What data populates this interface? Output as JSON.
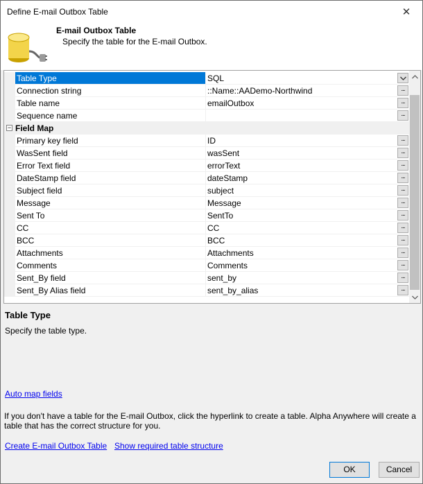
{
  "window": {
    "title": "Define E-mail Outbox Table",
    "close_glyph": "✕"
  },
  "header": {
    "icon": "database-plug-icon",
    "title": "E-mail Outbox Table",
    "subtitle": "Specify the table for the E-mail  Outbox."
  },
  "grid": {
    "rows_top": [
      {
        "name": "Table Type",
        "value": "SQL",
        "editor": "dropdown"
      },
      {
        "name": "Connection string",
        "value": "::Name::AADemo-Northwind",
        "editor": "ellipsis"
      },
      {
        "name": "Table name",
        "value": "emailOutbox",
        "editor": "ellipsis"
      },
      {
        "name": "Sequence name",
        "value": "",
        "editor": "ellipsis"
      }
    ],
    "category": {
      "label": "Field Map",
      "toggle": "−"
    },
    "rows_map": [
      {
        "name": "Primary key field",
        "value": "ID"
      },
      {
        "name": "WasSent field",
        "value": "wasSent"
      },
      {
        "name": "Error Text field",
        "value": "errorText"
      },
      {
        "name": "DateStamp field",
        "value": "dateStamp"
      },
      {
        "name": "Subject field",
        "value": "subject"
      },
      {
        "name": "Message",
        "value": "Message"
      },
      {
        "name": "Sent To",
        "value": "SentTo"
      },
      {
        "name": "CC",
        "value": "CC"
      },
      {
        "name": "BCC",
        "value": "BCC"
      },
      {
        "name": "Attachments",
        "value": "Attachments"
      },
      {
        "name": "Comments",
        "value": "Comments"
      },
      {
        "name": "Sent_By field",
        "value": "sent_by"
      },
      {
        "name": "Sent_By Alias field",
        "value": "sent_by_alias"
      }
    ],
    "ellipsis_label": "..."
  },
  "description": {
    "title": "Table Type",
    "text": "Specify the table type."
  },
  "links": {
    "auto_map": "Auto map fields",
    "create_table": "Create E-mail Outbox Table",
    "show_structure": "Show required table structure"
  },
  "info_text": "If you don't have a table for the E-mail Outbox, click the hyperlink to create a table. Alpha Anywhere will create a table that has the correct structure for you.",
  "buttons": {
    "ok": "OK",
    "cancel": "Cancel"
  },
  "colors": {
    "selection": "#0078d7",
    "link": "#0000ee"
  }
}
